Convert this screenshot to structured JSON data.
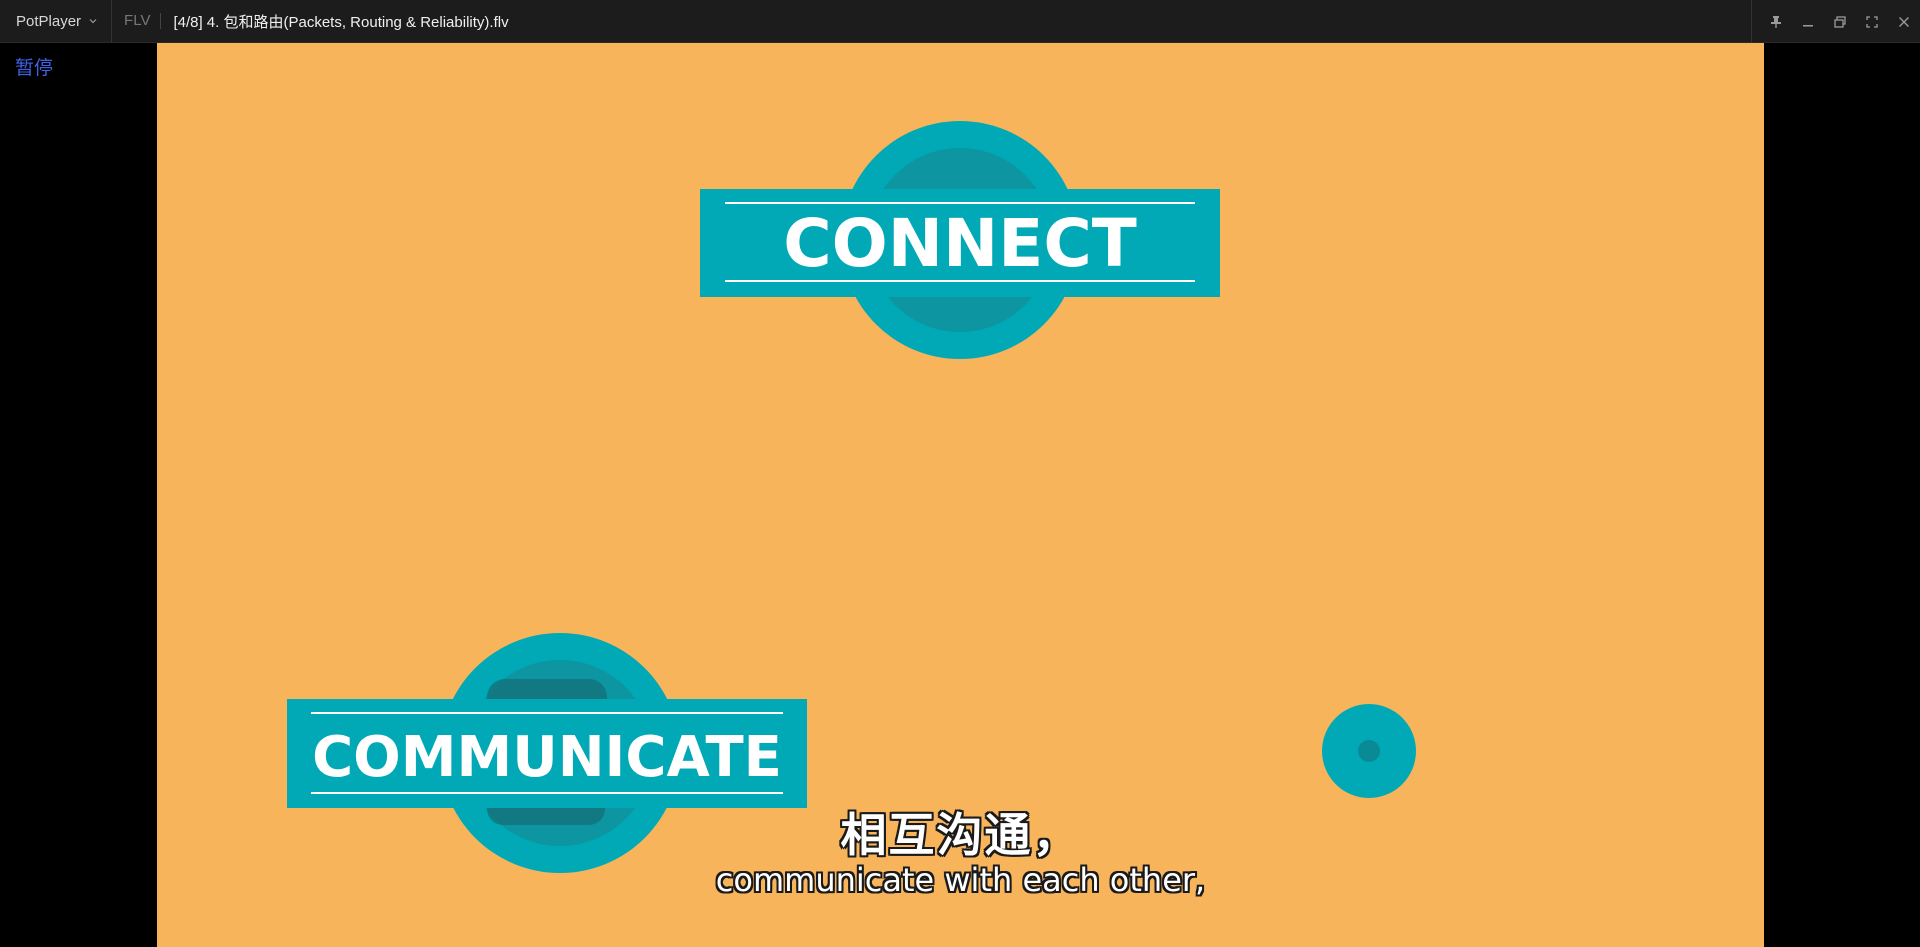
{
  "titlebar": {
    "app_name": "PotPlayer",
    "format": "FLV",
    "file_title": "[4/8] 4. 包和路由(Packets, Routing & Reliability).flv"
  },
  "status": {
    "paused_label": "暂停"
  },
  "window_controls": {
    "icons": [
      "pin-icon",
      "minimize-icon",
      "restore-icon",
      "fullscreen-icon",
      "close-icon"
    ]
  },
  "video": {
    "background_color": "#f8b45b",
    "accent_color": "#00a9b5",
    "badge_top_label": "CONNECT",
    "badge_bottom_label": "COMMUNICATE"
  },
  "subtitles": {
    "chinese": "相互沟通，",
    "english": "communicate with each other,"
  }
}
